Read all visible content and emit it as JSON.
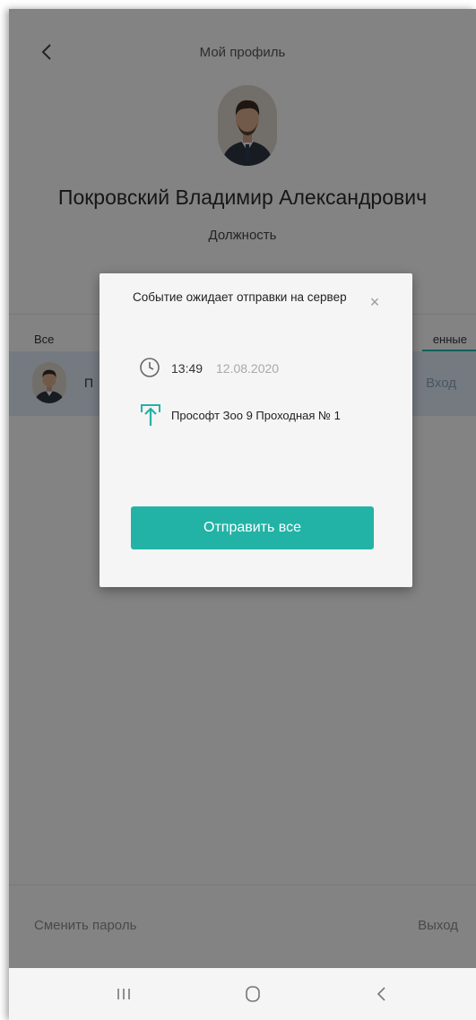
{
  "header": {
    "title": "Мой профиль"
  },
  "profile": {
    "name": "Покровский Владимир Александрович",
    "position": "Должность"
  },
  "tabs": {
    "all": "Все",
    "sent": "енные"
  },
  "event_row": {
    "name": "П",
    "direction": "Вход"
  },
  "footer": {
    "change_password": "Сменить пароль",
    "logout": "Выход"
  },
  "dialog": {
    "title": "Событие ожидает отправки на сервер",
    "close": "×",
    "time": "13:49",
    "date": "12.08.2020",
    "location": "Прософт Зоо 9 Проходная № 1",
    "send_all": "Отправить все"
  },
  "colors": {
    "accent": "#22b3a6",
    "row_highlight": "#dde7f4"
  },
  "icons": [
    "back-arrow-icon",
    "close-icon",
    "clock-icon",
    "upload-icon",
    "recent-apps-icon",
    "home-icon",
    "nav-back-icon"
  ]
}
